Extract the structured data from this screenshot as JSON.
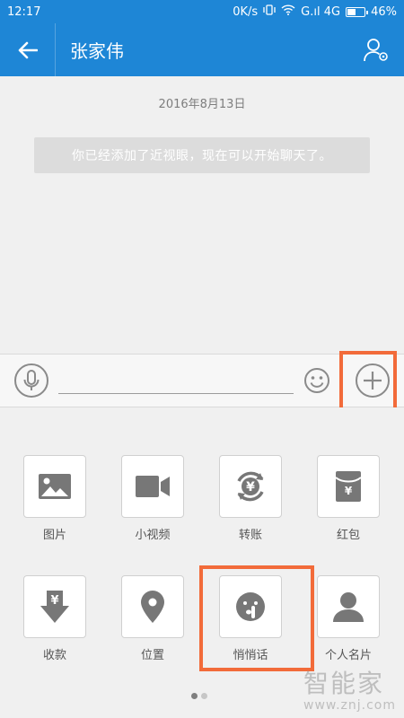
{
  "status_bar": {
    "time": "12:17",
    "speed": "0K/s",
    "network": "G.ıl 4G",
    "battery": "46%"
  },
  "header": {
    "title": "张家伟",
    "back_icon": "arrow-left-icon",
    "profile_icon": "user-settings-icon"
  },
  "chat": {
    "date": "2016年8月13日",
    "system_message": "你已经添加了近视眼，现在可以开始聊天了。"
  },
  "input_bar": {
    "value": "",
    "placeholder": ""
  },
  "panel": {
    "items": [
      {
        "label": "图片",
        "icon": "image-icon"
      },
      {
        "label": "小视频",
        "icon": "video-camera-icon"
      },
      {
        "label": "转账",
        "icon": "transfer-yuan-icon"
      },
      {
        "label": "红包",
        "icon": "red-envelope-icon"
      },
      {
        "label": "收款",
        "icon": "receive-money-icon"
      },
      {
        "label": "位置",
        "icon": "location-pin-icon"
      },
      {
        "label": "悄悄话",
        "icon": "whisper-icon"
      },
      {
        "label": "个人名片",
        "icon": "contact-card-icon"
      }
    ]
  },
  "watermark": {
    "main": "智能家",
    "sub": "www.znj.com"
  },
  "colors": {
    "header_bg": "#1e86d6",
    "highlight": "#f26b3a"
  }
}
